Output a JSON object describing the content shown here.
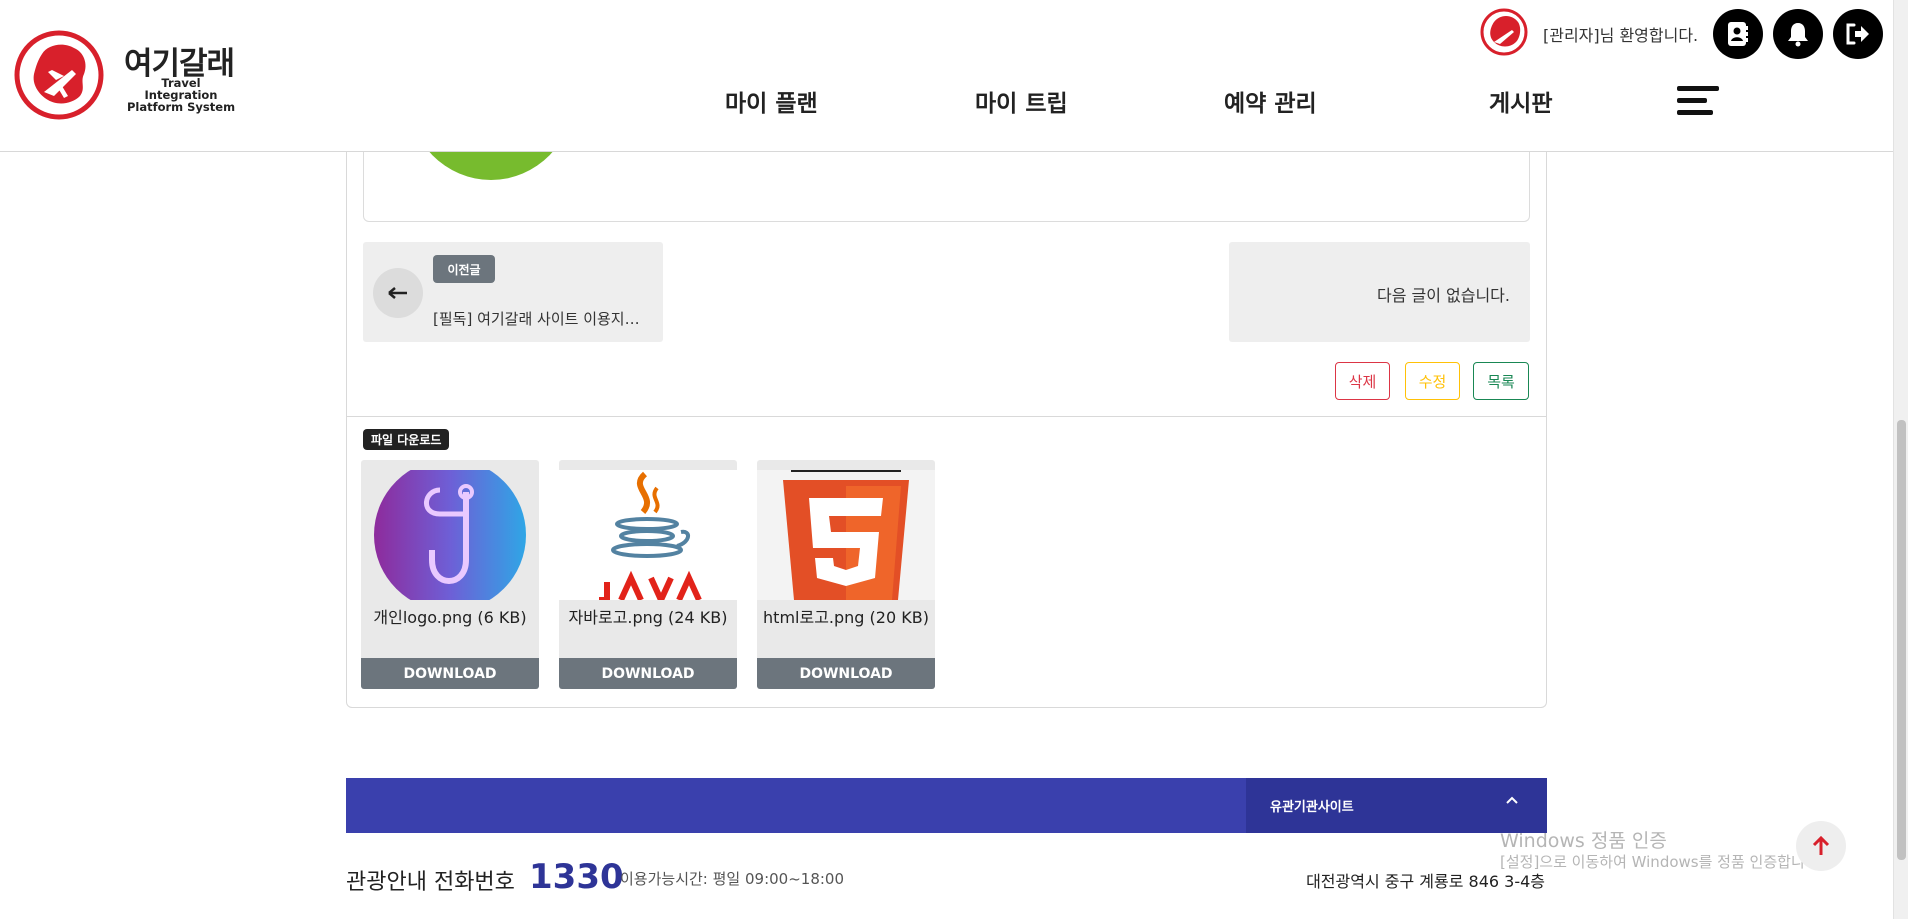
{
  "header": {
    "brand_name": "여기갈래",
    "brand_subtitle": "Travel Integration Platform System",
    "welcome": "[관리자]님 환영합니다.",
    "nav": [
      "마이 플랜",
      "마이 트립",
      "예약 관리",
      "게시판"
    ],
    "icons": [
      "contact-book-icon",
      "bell-icon",
      "logout-icon",
      "hamburger-menu-icon"
    ]
  },
  "post_nav": {
    "prev_badge": "이전글",
    "prev_title": "[필독] 여기갈래 사이트 이용지…",
    "next_text": "다음 글이 없습니다."
  },
  "actions": {
    "delete": "삭제",
    "edit": "수정",
    "list": "목록",
    "colors": {
      "delete": "#dc3545",
      "edit": "#ffc107",
      "list": "#198754"
    }
  },
  "files": {
    "badge": "파일 다운로드",
    "items": [
      {
        "name": "개인logo.png (6 KB)",
        "download": "DOWNLOAD",
        "thumb": "personal-logo-thumb"
      },
      {
        "name": "자바로고.png (24 KB)",
        "download": "DOWNLOAD",
        "thumb": "java-logo-thumb"
      },
      {
        "name": "html로고.png (20 KB)",
        "download": "DOWNLOAD",
        "thumb": "html5-logo-thumb"
      }
    ]
  },
  "footer": {
    "related_sites": "유관기관사이트",
    "tel_label": "관광안내 전화번호",
    "tel_number": "1330",
    "hours": "이용가능시간: 평일 09:00~18:00",
    "address": "대전광역시 중구 계룡로 846 3-4층",
    "accent": "#3a40ad"
  },
  "os_watermark": {
    "line1": "Windows 정품 인증",
    "line2": "[설정]으로 이동하여 Windows를 정품 인증합니다."
  }
}
